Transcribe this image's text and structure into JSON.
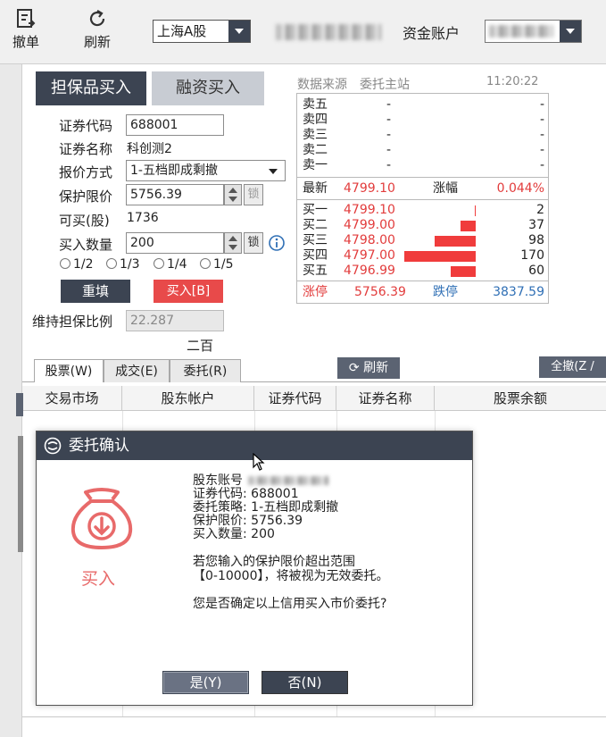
{
  "toolbar": {
    "cancel_label": "撤单",
    "refresh_label": "刷新",
    "market_select": "上海A股",
    "fund_account_label": "资金账户"
  },
  "order_form": {
    "tabs": [
      "担保品买入",
      "融资买入"
    ],
    "labels": {
      "code": "证券代码",
      "name": "证券名称",
      "quote_type": "报价方式",
      "limit_price": "保护限价",
      "buyable": "可买(股)",
      "quantity": "买入数量",
      "maintenance_ratio": "维持担保比例"
    },
    "values": {
      "code": "688001",
      "name": "科创测2",
      "quote_type": "1-五档即成剩撤",
      "limit_price": "5756.39",
      "buyable": "1736",
      "quantity": "200",
      "maintenance_ratio": "22.287",
      "quantity_hint": "二百"
    },
    "lock_label": "锁",
    "fractions": [
      "1/2",
      "1/3",
      "1/4",
      "1/5"
    ],
    "reset_label": "重填",
    "buy_label": "买入[B]"
  },
  "quote": {
    "source_label": "数据来源",
    "source_value": "委托主站",
    "time": "11:20:22",
    "asks": [
      {
        "label": "卖五",
        "price": "-",
        "vol": "-"
      },
      {
        "label": "卖四",
        "price": "-",
        "vol": "-"
      },
      {
        "label": "卖三",
        "price": "-",
        "vol": "-"
      },
      {
        "label": "卖二",
        "price": "-",
        "vol": "-"
      },
      {
        "label": "卖一",
        "price": "-",
        "vol": "-"
      }
    ],
    "last_label": "最新",
    "last_price": "4799.10",
    "change_label": "涨幅",
    "change_value": "0.044%",
    "bids": [
      {
        "label": "买一",
        "price": "4799.10",
        "vol": "2",
        "vol_num": 2
      },
      {
        "label": "买二",
        "price": "4799.00",
        "vol": "37",
        "vol_num": 37
      },
      {
        "label": "买三",
        "price": "4798.00",
        "vol": "98",
        "vol_num": 98
      },
      {
        "label": "买四",
        "price": "4797.00",
        "vol": "170",
        "vol_num": 170
      },
      {
        "label": "买五",
        "price": "4796.99",
        "vol": "60",
        "vol_num": 60
      }
    ],
    "limit_up_label": "涨停",
    "limit_up": "5756.39",
    "limit_down_label": "跌停",
    "limit_down": "3837.59"
  },
  "bottom": {
    "tabs": [
      "股票(W)",
      "成交(E)",
      "委托(R)"
    ],
    "refresh_label": "刷新",
    "cancel_all_label": "全撤(Z /",
    "columns": [
      "交易市场",
      "股东帐户",
      "证券代码",
      "证券名称",
      "股票余额"
    ]
  },
  "dialog": {
    "title": "委托确认",
    "icon_label": "买入",
    "lines": [
      "股东账号",
      "证券代码: 688001",
      "委托策略: 1-五档即成剩撤",
      "保护限价: 5756.39",
      "买入数量: 200"
    ],
    "warning_1": "若您输入的保护限价超出范围",
    "warning_2": "【0-10000】，将被视为无效委托。",
    "question": "您是否确定以上信用买入市价委托?",
    "yes_label": "是(Y)",
    "no_label": "否(N)"
  },
  "colors": {
    "accent_dark": "#3c4452",
    "buy_red": "#e23c3c",
    "down_blue": "#2f6fb5"
  }
}
